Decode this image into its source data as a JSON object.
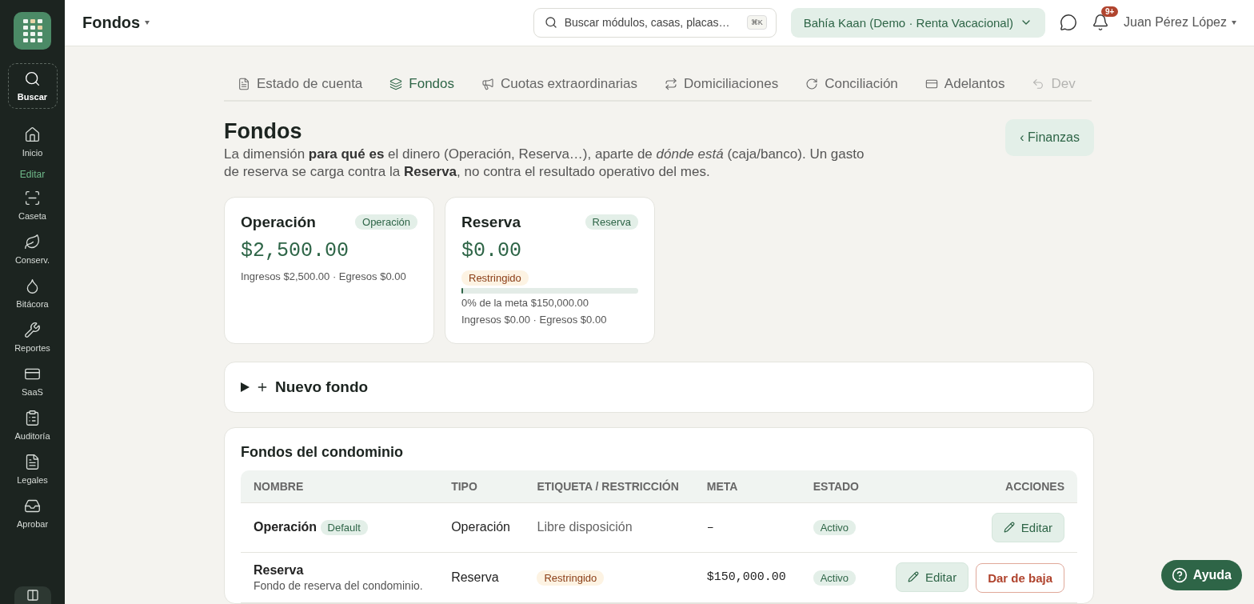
{
  "sidebar": {
    "items": [
      {
        "kind": "search",
        "label": "Buscar"
      },
      {
        "kind": "item",
        "label": "Inicio"
      },
      {
        "kind": "section",
        "label": "Editar"
      },
      {
        "kind": "item",
        "label": "Caseta"
      },
      {
        "kind": "item",
        "label": "Conserv."
      },
      {
        "kind": "item",
        "label": "Bitácora"
      },
      {
        "kind": "item",
        "label": "Reportes"
      },
      {
        "kind": "item",
        "label": "SaaS"
      },
      {
        "kind": "item",
        "label": "Auditoría"
      },
      {
        "kind": "item",
        "label": "Legales"
      },
      {
        "kind": "item",
        "label": "Aprobar"
      }
    ]
  },
  "header": {
    "title": "Fondos",
    "search": {
      "placeholder": "Buscar módulos, casas, placas…",
      "shortcut": "⌘K"
    },
    "workspace": "Bahía Kaan (Demo · Renta Vacacional)",
    "notifications": "9+",
    "user": "Juan Pérez López"
  },
  "tabs": [
    {
      "label": "Estado de cuenta",
      "selected": false
    },
    {
      "label": "Fondos",
      "selected": true
    },
    {
      "label": "Cuotas extraordinarias",
      "selected": false
    },
    {
      "label": "Domiciliaciones",
      "selected": false
    },
    {
      "label": "Conciliación",
      "selected": false
    },
    {
      "label": "Adelantos",
      "selected": false
    },
    {
      "label": "Dev",
      "selected": false
    }
  ],
  "page": {
    "title": "Fondos",
    "description": "La dimensión **para qué es** el dinero (Operación, Reserva…), aparte de *dónde está* (caja/banco). Un gasto de reserva se carga contra la **Reserva**, no contra el resultado operativo del mes.",
    "back": "‹ Finanzas"
  },
  "funds": [
    {
      "name": "Operación",
      "badge": "Operación",
      "amount": "$2,500.00",
      "summary": "Ingresos $2,500.00 · Egresos $0.00"
    },
    {
      "name": "Reserva",
      "badge": "Reserva",
      "amount": "$0.00",
      "restriction": "Restringido",
      "level": 0,
      "goal": "0% de la meta $150,000.00",
      "summary": "Ingresos $0.00 · Egresos $0.00"
    }
  ],
  "new_fund": {
    "label": "Nuevo fondo",
    "expanded": false
  },
  "table": {
    "title": "Fondos del condominio",
    "columns": [
      "NOMBRE",
      "TIPO",
      "ETIQUETA / RESTRICCIÓN",
      "META",
      "ESTADO",
      "ACCIONES"
    ],
    "rows": [
      {
        "name": "Operación",
        "default": "Default",
        "type": "Operación",
        "label": {
          "kind": "text",
          "text": "Libre disposición"
        },
        "goal": "–",
        "status": "Activo",
        "actions": [
          {
            "kind": "edit",
            "label": "Editar"
          }
        ]
      },
      {
        "name": "Reserva",
        "description": "Fondo de reserva del condominio.",
        "type": "Reserva",
        "label": {
          "kind": "tag",
          "text": "Restringido"
        },
        "goal": "$150,000.00",
        "status": "Activo",
        "actions": [
          {
            "kind": "edit",
            "label": "Editar"
          },
          {
            "kind": "deactivate",
            "label": "Dar de baja"
          }
        ]
      }
    ]
  },
  "help": "Ayuda"
}
